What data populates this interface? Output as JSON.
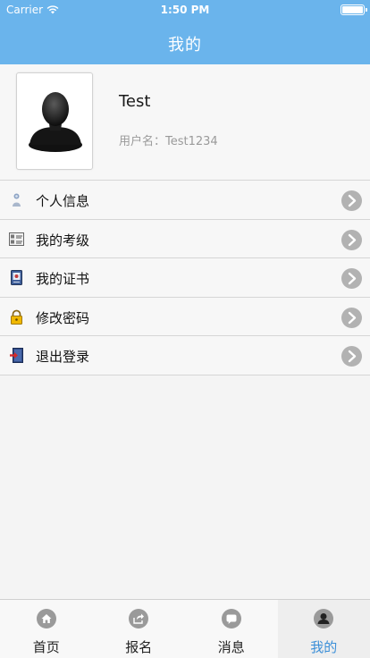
{
  "status_bar": {
    "carrier": "Carrier",
    "time": "1:50 PM",
    "battery_level": 1.0
  },
  "nav": {
    "title": "我的"
  },
  "profile": {
    "name": "Test",
    "username": "用户名：Test1234"
  },
  "menu": [
    {
      "label": "个人信息",
      "icon": "person-icon"
    },
    {
      "label": "我的考级",
      "icon": "exam-icon"
    },
    {
      "label": "我的证书",
      "icon": "certificate-icon"
    },
    {
      "label": "修改密码",
      "icon": "lock-icon"
    },
    {
      "label": "退出登录",
      "icon": "logout-icon"
    }
  ],
  "tabs": [
    {
      "label": "首页",
      "icon": "home-icon"
    },
    {
      "label": "报名",
      "icon": "share-icon"
    },
    {
      "label": "消息",
      "icon": "message-icon"
    },
    {
      "label": "我的",
      "icon": "user-icon",
      "active": true
    }
  ],
  "colors": {
    "accent": "#6ab4ec",
    "active_tab": "#3b8fd8"
  }
}
